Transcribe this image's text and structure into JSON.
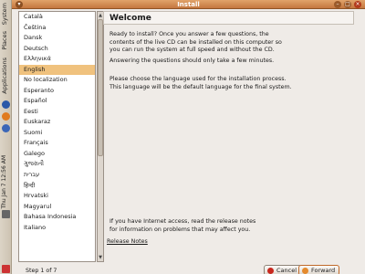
{
  "window": {
    "title": "Install"
  },
  "panel": {
    "menus": [
      "System",
      "Places",
      "Applications"
    ],
    "clock": "Thu Jan 7 12:56 AM"
  },
  "languages": {
    "items": [
      "Català",
      "Čeština",
      "Dansk",
      "Deutsch",
      "Ελληνικά",
      "English",
      "No localization",
      "Esperanto",
      "Español",
      "Eesti",
      "Euskaraz",
      "Suomi",
      "Français",
      "Galego",
      "ગુજરાતી",
      "עברית",
      "हिन्दी",
      "Hrvatski",
      "Magyarul",
      "Bahasa Indonesia",
      "Italiano"
    ],
    "selected": "English"
  },
  "main": {
    "heading": "Welcome",
    "intro": "Ready to install? Once you answer a few questions, the\ncontents of the live CD can be installed on this computer so\nyou can run the system at full speed and without the CD.",
    "answering": "Answering the questions should only take a few minutes.",
    "choose": "Please choose the language used for the installation process.\nThis language will be the default language for the final system.",
    "internet": "If you have Internet access, read the release notes\nfor information on problems that may affect you.",
    "release_notes_link": "Release Notes"
  },
  "footer": {
    "step": "Step 1 of 7",
    "cancel_label": "Cancel",
    "forward_label": "Forward"
  },
  "colors": {
    "titlebar": "#c98248",
    "selection": "#f0c27e"
  }
}
